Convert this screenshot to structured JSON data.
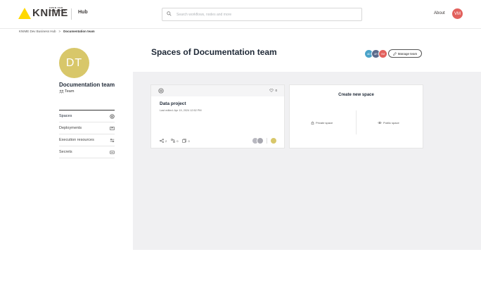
{
  "header": {
    "logo_text": "KNIME",
    "logo_tagline": "OPEN FOR INNOVATION",
    "hub_label": "Hub",
    "search_placeholder": "Search workflows, nodes and more",
    "about_label": "About",
    "user_initials": "VM"
  },
  "breadcrumb": {
    "root": "KNIME Dev Business Hub",
    "separator": ">",
    "current": "Documentation team"
  },
  "team": {
    "initials": "DT",
    "name": "Documentation team",
    "type": "Team"
  },
  "nav": {
    "items": [
      {
        "label": "Spaces",
        "icon": "spaces-icon"
      },
      {
        "label": "Deployments",
        "icon": "deployments-icon"
      },
      {
        "label": "Execution resources",
        "icon": "execution-resources-icon"
      },
      {
        "label": "Secrets",
        "icon": "secrets-icon"
      }
    ]
  },
  "main": {
    "title": "Spaces of Documentation team",
    "manage_label": "Manage team",
    "members": [
      {
        "initials": "AD",
        "color": "#4aa3c9"
      },
      {
        "initials": "AR",
        "color": "#5b6b8c"
      },
      {
        "initials": "VM",
        "color": "#e2615d"
      }
    ]
  },
  "project": {
    "title": "Data project",
    "last_edited": "Last edited: Apr 19, 2024 12:52 PM",
    "likes": "0",
    "shares": "2",
    "workflows": "0",
    "components": "0"
  },
  "create": {
    "title": "Create new space",
    "private_label": "Private space",
    "public_label": "Public space"
  },
  "colors": {
    "accent_yellow": "#ffd800",
    "team_avatar": "#d8c76a",
    "user_avatar": "#e2615d",
    "content_bg": "#f0f0f2"
  }
}
